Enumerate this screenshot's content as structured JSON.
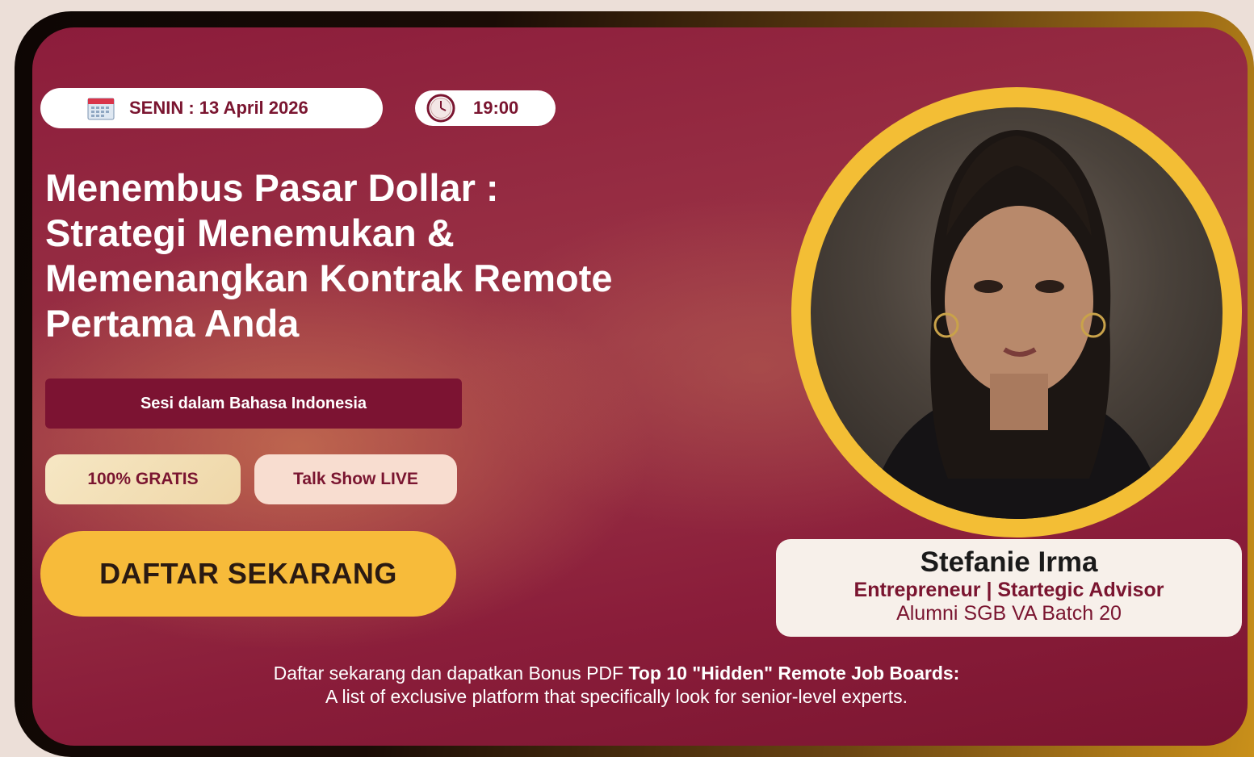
{
  "event": {
    "date_label": "SENIN : 13 April 2026",
    "time_label": "19:00"
  },
  "title_lines": [
    "Menembus Pasar Dollar :",
    "Strategi Menemukan &",
    "Memenangkan Kontrak Remote",
    "Pertama Anda"
  ],
  "session_language": "Sesi dalam Bahasa Indonesia",
  "chips": {
    "free": "100% GRATIS",
    "format": "Talk Show LIVE"
  },
  "cta_label": "DAFTAR SEKARANG",
  "speaker": {
    "name": "Stefanie Irma",
    "role": "Entrepreneur | Startegic Advisor",
    "alumni": "Alumni SGB VA Batch 20"
  },
  "bonus": {
    "prefix": "Daftar sekarang dan dapatkan Bonus PDF ",
    "highlight": "Top 10 \"Hidden\" Remote Job Boards:",
    "line2": "A list of exclusive platform that specifically look for senior-level experts."
  },
  "icons": [
    "calendar-icon",
    "clock-icon"
  ],
  "colors": {
    "brand_maroon": "#7c1332",
    "cta_yellow": "#f7bb3a",
    "ring_gold": "#f3be35"
  }
}
